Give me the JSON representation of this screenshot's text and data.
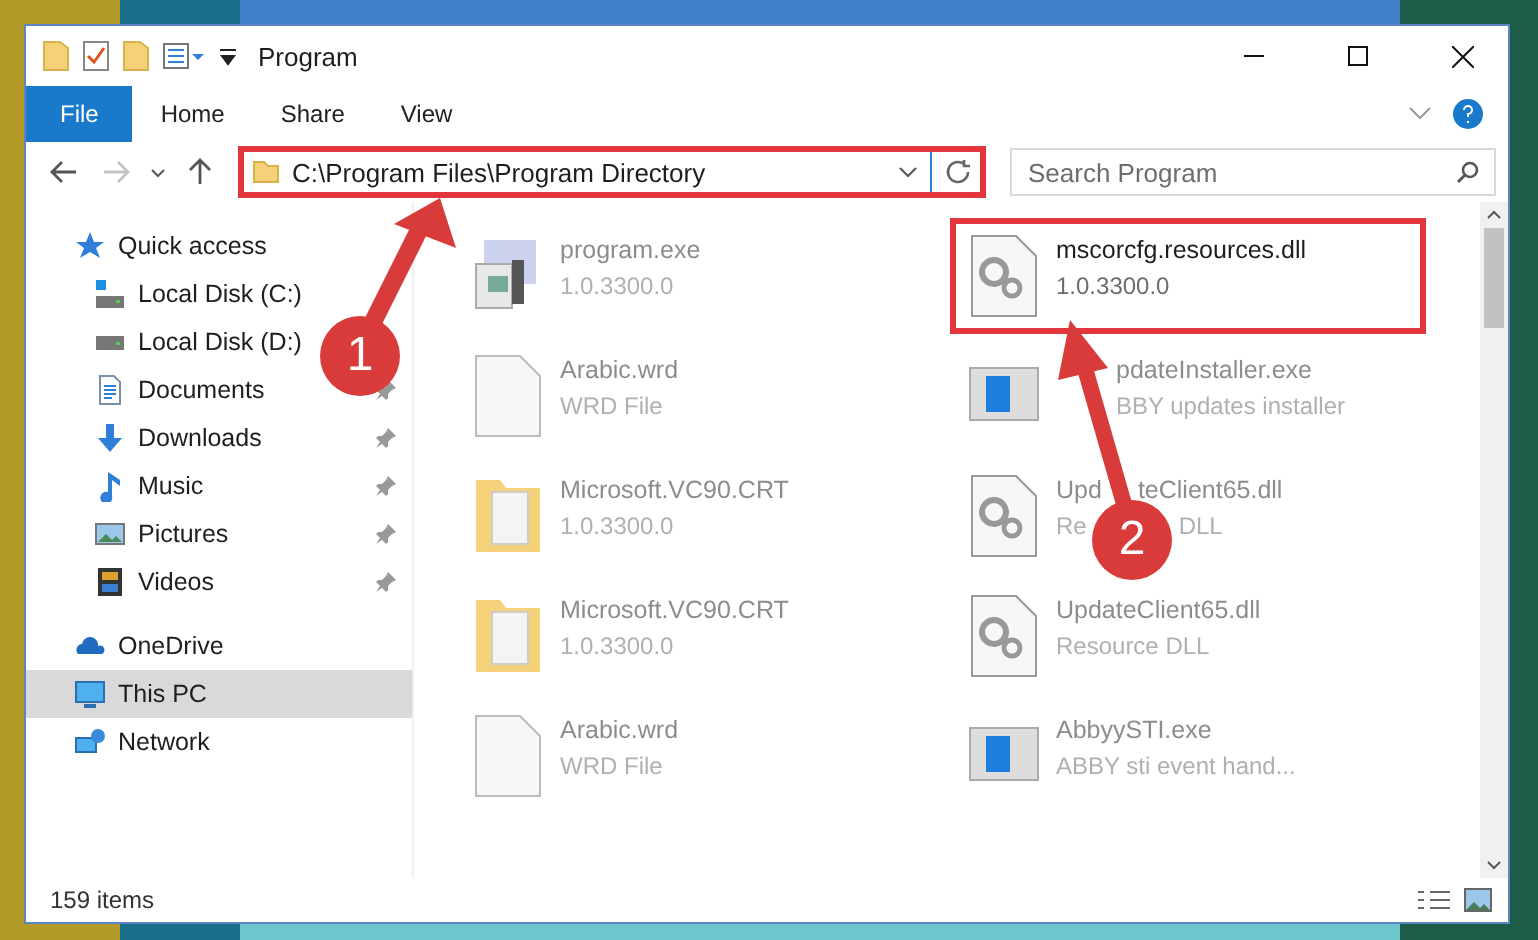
{
  "window": {
    "title": "Program"
  },
  "ribbon_tabs": [
    {
      "label": "File",
      "selected": true
    },
    {
      "label": "Home",
      "selected": false
    },
    {
      "label": "Share",
      "selected": false
    },
    {
      "label": "View",
      "selected": false
    }
  ],
  "address": {
    "path": "C:\\Program Files\\Program Directory",
    "highlighted": true
  },
  "search": {
    "placeholder": "Search Program"
  },
  "sidebar": {
    "items": [
      {
        "kind": "star",
        "label": "Quick access",
        "pinned": false,
        "selected": false,
        "group": true
      },
      {
        "kind": "disk-c",
        "label": "Local Disk (C:)",
        "pinned": false,
        "selected": false,
        "group": false
      },
      {
        "kind": "disk",
        "label": "Local Disk (D:)",
        "selected": false,
        "group": false
      },
      {
        "kind": "document",
        "label": "Documents",
        "pinned": true,
        "selected": false,
        "group": false
      },
      {
        "kind": "download",
        "label": "Downloads",
        "pinned": true,
        "selected": false,
        "group": false
      },
      {
        "kind": "music",
        "label": "Music",
        "pinned": true,
        "selected": false,
        "group": false
      },
      {
        "kind": "pictures",
        "label": "Pictures",
        "pinned": true,
        "selected": false,
        "group": false
      },
      {
        "kind": "videos",
        "label": "Videos",
        "pinned": true,
        "selected": false,
        "group": false
      },
      {
        "kind": "cloud",
        "label": "OneDrive",
        "pinned": false,
        "selected": false,
        "group": true
      },
      {
        "kind": "pc",
        "label": "This PC",
        "pinned": false,
        "selected": true,
        "group": true
      },
      {
        "kind": "network",
        "label": "Network",
        "pinned": false,
        "selected": false,
        "group": true
      }
    ]
  },
  "files": [
    {
      "kind": "installer",
      "name": "program.exe",
      "detail": "1.0.3300.0",
      "faded": true,
      "highlighted": false
    },
    {
      "kind": "dll",
      "name": "mscorcfg.resources.dll",
      "detail": "1.0.3300.0",
      "faded": false,
      "highlighted": true
    },
    {
      "kind": "blank",
      "name": "Arabic.wrd",
      "detail": "WRD File",
      "faded": true,
      "highlighted": false
    },
    {
      "kind": "window",
      "name": "pdateInstaller.exe",
      "detail": "BBY updates installer",
      "faded": true,
      "highlighted": false,
      "lead_hidden": true
    },
    {
      "kind": "folder-doc",
      "name": "Microsoft.VC90.CRT",
      "detail": "1.0.3300.0",
      "faded": true,
      "highlighted": false
    },
    {
      "kind": "dll",
      "name": "Upd",
      "name_tail": "teClient65.dll",
      "detail": "Re",
      "detail_tail": "DLL",
      "faded": true,
      "highlighted": false
    },
    {
      "kind": "folder-doc",
      "name": "Microsoft.VC90.CRT",
      "detail": "1.0.3300.0",
      "faded": true,
      "highlighted": false
    },
    {
      "kind": "dll",
      "name": "UpdateClient65.dll",
      "detail": "Resource DLL",
      "faded": true,
      "highlighted": false
    },
    {
      "kind": "blank",
      "name": "Arabic.wrd",
      "detail": "WRD File",
      "faded": true,
      "highlighted": false
    },
    {
      "kind": "window",
      "name": "AbbyySTI.exe",
      "detail": "ABBY sti event hand...",
      "faded": true,
      "highlighted": false
    }
  ],
  "status_bar": {
    "count": "159 items"
  },
  "annotations": [
    {
      "label": "1"
    },
    {
      "label": "2"
    }
  ]
}
